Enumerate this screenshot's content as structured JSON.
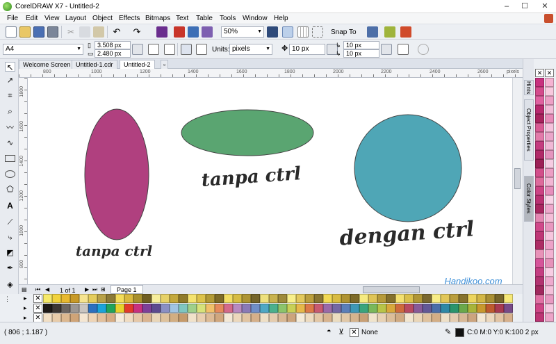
{
  "window": {
    "title": "CorelDRAW X7 - Untitled-2",
    "min": "–",
    "max": "☐",
    "close": "✕"
  },
  "menu": [
    "File",
    "Edit",
    "View",
    "Layout",
    "Object",
    "Effects",
    "Bitmaps",
    "Text",
    "Table",
    "Tools",
    "Window",
    "Help"
  ],
  "toolbar": {
    "zoom": "50%",
    "snap_label": "Snap To"
  },
  "propbar": {
    "page_size": "A4",
    "width": "3.508 px",
    "height": "2.480 px",
    "units_label": "Units:",
    "units": "pixels",
    "nudge": "10 px",
    "dup_x": "10 px",
    "dup_y": "10 px"
  },
  "tabs": [
    "Welcome Screen",
    "Untitled-1.cdr",
    "Untitled-2"
  ],
  "ruler": {
    "h_labels": [
      "800",
      "1000",
      "1200",
      "1400",
      "1600",
      "1800",
      "2000",
      "2200",
      "2400",
      "2600"
    ],
    "units": "pixels",
    "v_labels": [
      "1800",
      "1600",
      "1400",
      "1200",
      "1000",
      "800"
    ]
  },
  "canvas": {
    "caption1": "tanpa ctrl",
    "caption2": "tanpa ctrl",
    "caption3": "dengan ctrl",
    "watermark": "Handikoo.com",
    "colors": {
      "magenta_ellipse": "#b0407f",
      "green_ellipse": "#5aa571",
      "teal_circle": "#4fa6b6"
    }
  },
  "pagenav": {
    "count": "1 of 1",
    "page_tab": "Page 1"
  },
  "dock": {
    "hints": "Hints",
    "object_properties": "Object Properties",
    "color_styles": "Color Styles"
  },
  "status": {
    "coords": "( 806 ; 1.187 )",
    "fill": "None",
    "outline": "C:0 M:0 Y:0 K:100  2 px"
  }
}
